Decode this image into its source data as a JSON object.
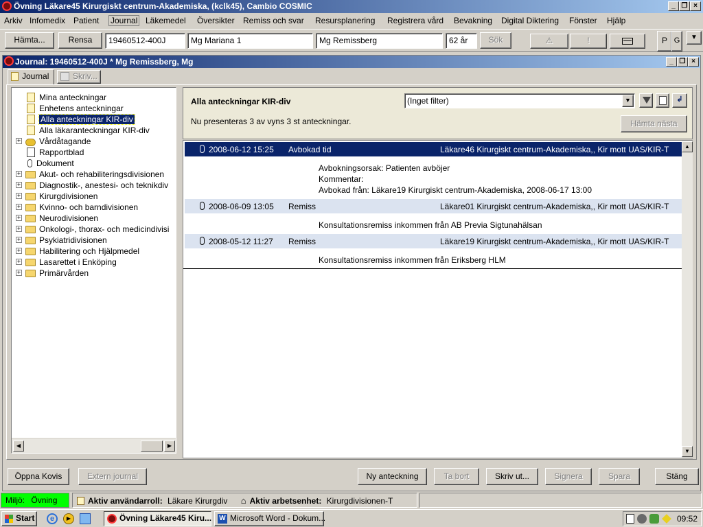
{
  "app": {
    "title": "Övning Läkare45 Kirurgiskt centrum-Akademiska, (kclk45), Cambio COSMIC"
  },
  "menu": [
    "Arkiv",
    "Infomedix",
    "Patient",
    "Journal",
    "Läkemedel",
    "Översikter",
    "Remiss och svar",
    "Resursplanering",
    "Registrera vård",
    "Bevakning",
    "Digital Diktering",
    "Fönster",
    "Hjälp"
  ],
  "toolbar": {
    "fetch_label": "Hämta...",
    "clear_label": "Rensa",
    "personnummer": "19460512-400J",
    "first_name": "Mg Mariana 1",
    "last_name": "Mg Remissberg",
    "age": "62 år",
    "search_label": "Sök",
    "warning_label": "⚠",
    "exclamation_label": "!",
    "p_label": "P",
    "g_label": "G"
  },
  "journal_window": {
    "title": "Journal: 19460512-400J * Mg Remissberg, Mg",
    "tabs": [
      "Journal",
      "Skriv..."
    ]
  },
  "tree": [
    {
      "label": "Mina anteckningar",
      "icon": "note-icon",
      "expandable": false,
      "selected": false
    },
    {
      "label": "Enhetens anteckningar",
      "icon": "note-icon",
      "expandable": false,
      "selected": false
    },
    {
      "label": "Alla anteckningar KIR-div",
      "icon": "note-icon",
      "expandable": false,
      "selected": true
    },
    {
      "label": "Alla läkaranteckningar KIR-div",
      "icon": "note-icon",
      "expandable": false,
      "selected": false
    },
    {
      "label": "Vårdåtagande",
      "icon": "coins-icon",
      "expandable": true,
      "selected": false
    },
    {
      "label": "Rapportblad",
      "icon": "report-icon",
      "expandable": false,
      "selected": false
    },
    {
      "label": "Dokument",
      "icon": "paperclip-icon",
      "expandable": false,
      "selected": false
    },
    {
      "label": "Akut- och rehabiliteringsdivisionen",
      "icon": "folder-icon",
      "expandable": true,
      "selected": false
    },
    {
      "label": "Diagnostik-, anestesi- och teknikdiv",
      "icon": "folder-icon",
      "expandable": true,
      "selected": false
    },
    {
      "label": "Kirurgdivisionen",
      "icon": "folder-icon",
      "expandable": true,
      "selected": false
    },
    {
      "label": "Kvinno- och barndivisionen",
      "icon": "folder-icon",
      "expandable": true,
      "selected": false
    },
    {
      "label": "Neurodivisionen",
      "icon": "folder-icon",
      "expandable": true,
      "selected": false
    },
    {
      "label": "Onkologi-, thorax- och medicindivisi",
      "icon": "folder-icon",
      "expandable": true,
      "selected": false
    },
    {
      "label": "Psykiatridivisionen",
      "icon": "folder-icon",
      "expandable": true,
      "selected": false
    },
    {
      "label": "Habilitering och Hjälpmedel",
      "icon": "folder-icon",
      "expandable": true,
      "selected": false
    },
    {
      "label": "Lasarettet i Enköping",
      "icon": "folder-icon",
      "expandable": true,
      "selected": false
    },
    {
      "label": "Primärvården",
      "icon": "folder-icon",
      "expandable": true,
      "selected": false
    }
  ],
  "notes_header": {
    "title": "Alla anteckningar KIR-div",
    "filter_value": "(Inget filter)",
    "count_text": "Nu presenteras 3 av vyns 3 st anteckningar.",
    "fetch_next_label": "Hämta nästa"
  },
  "notes": [
    {
      "datetime": "2008-06-12 15:25",
      "type": "Avbokad tid",
      "author": "Läkare46 Kirurgiskt centrum-Akademiska,, Kir mott UAS/KIR-T",
      "details": [
        "Avbokningsorsak: Patienten avböjer",
        "Kommentar:",
        "Avbokad från: Läkare19 Kirurgiskt centrum-Akademiska, 2008-06-17 13:00"
      ],
      "active": true
    },
    {
      "datetime": "2008-06-09 13:05",
      "type": "Remiss",
      "author": "Läkare01 Kirurgiskt centrum-Akademiska,, Kir mott UAS/KIR-T",
      "details": [
        "Konsultationsremiss inkommen från AB Previa Sigtunahälsan"
      ],
      "active": false
    },
    {
      "datetime": "2008-05-12 11:27",
      "type": "Remiss",
      "author": "Läkare19 Kirurgiskt centrum-Akademiska,, Kir mott UAS/KIR-T",
      "details": [
        "Konsultationsremiss inkommen från Eriksberg HLM"
      ],
      "active": false
    }
  ],
  "bottom_buttons": {
    "open_kovis": "Öppna Kovis",
    "external_journal": "Extern journal",
    "new_note": "Ny anteckning",
    "delete": "Ta bort",
    "print": "Skriv ut...",
    "sign": "Signera",
    "save": "Spara",
    "close": "Stäng"
  },
  "status": {
    "env_label": "Miljö:",
    "env_value": "Övning",
    "role_label": "Aktiv användarroll:",
    "role_value": "Läkare Kirurgdiv",
    "unit_label": "Aktiv arbetsenhet:",
    "unit_value": "Kirurgdivisionen-T"
  },
  "taskbar": {
    "start_label": "Start",
    "tasks": [
      "Övning Läkare45 Kiru...",
      "Microsoft Word - Dokum..."
    ],
    "clock": "09:52"
  },
  "colors": {
    "titlebar_dark": "#0a246a",
    "titlebar_light": "#a6caf0",
    "env_green": "#00ff00",
    "active_row": "#0a246a",
    "inactive_row": "#dbe3f0"
  }
}
